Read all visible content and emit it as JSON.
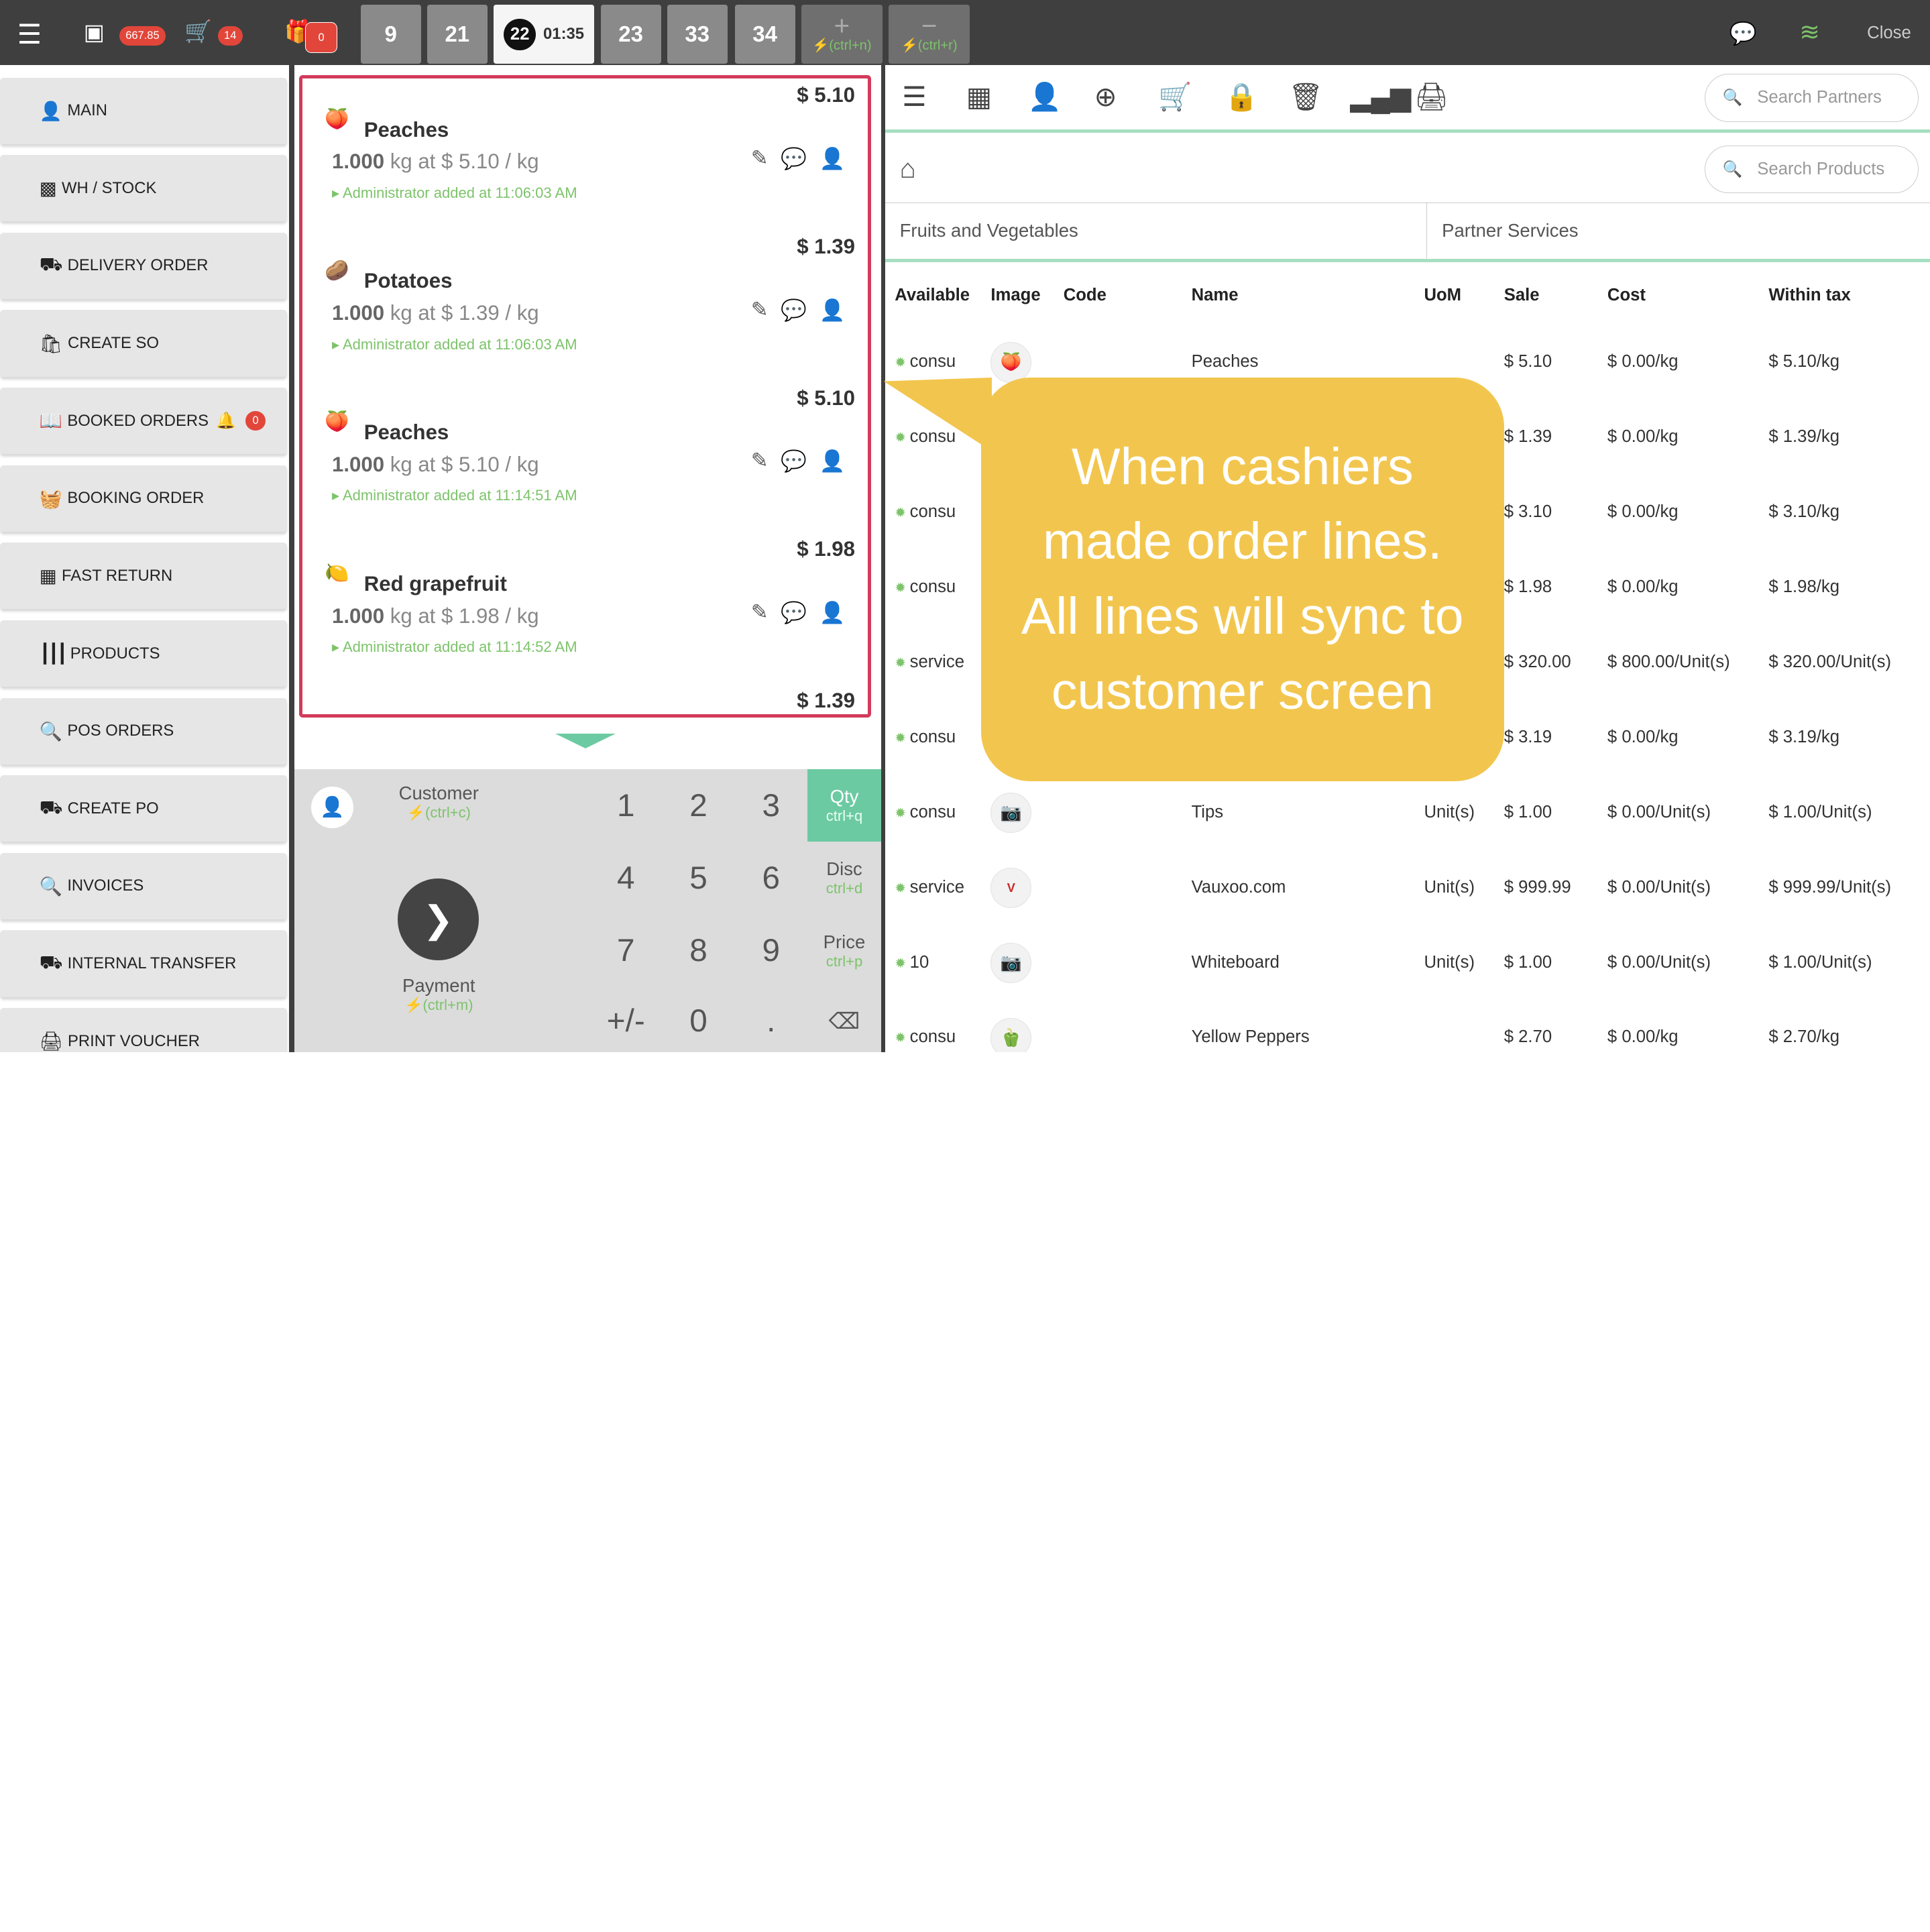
{
  "topbar": {
    "menu_icon": "list-icon",
    "cash_amount": "667.85",
    "cart_count": "14",
    "gift_count": "0",
    "order_tabs": [
      {
        "label": "9"
      },
      {
        "label": "21"
      },
      {
        "label": "22",
        "time": "01:35",
        "active": true
      },
      {
        "label": "23"
      },
      {
        "label": "33"
      },
      {
        "label": "34"
      }
    ],
    "add_tab_hint": "(ctrl+n)",
    "remove_tab_hint": "(ctrl+r)",
    "close_label": "Close"
  },
  "sidebar": {
    "items": [
      {
        "label": "MAIN",
        "icon": "user-icon"
      },
      {
        "label": "WH / STOCK",
        "icon": "sitemap-icon"
      },
      {
        "label": "DELIVERY ORDER",
        "icon": "truck-icon"
      },
      {
        "label": "CREATE SO",
        "icon": "shopping-bag-icon"
      },
      {
        "label": "BOOKED ORDERS",
        "icon": "book-icon",
        "badge": "0"
      },
      {
        "label": "BOOKING ORDER",
        "icon": "basket-icon"
      },
      {
        "label": "FAST RETURN",
        "icon": "building-icon"
      },
      {
        "label": "PRODUCTS",
        "icon": "barcode-icon"
      },
      {
        "label": "POS ORDERS",
        "icon": "search-icon"
      },
      {
        "label": "CREATE PO",
        "icon": "truck-icon"
      },
      {
        "label": "INVOICES",
        "icon": "search-icon"
      },
      {
        "label": "INTERNAL TRANSFER",
        "icon": "truck-icon"
      },
      {
        "label": "PRINT VOUCHER",
        "icon": "print-icon"
      }
    ]
  },
  "order_lines": [
    {
      "price": "$ 5.10",
      "name": "Peaches",
      "qty": "1.000",
      "unit_text": "kg at $ 5.10 / kg",
      "note": "Administrator added at 11:06:03 AM",
      "icon": "peach-icon"
    },
    {
      "price": "$ 1.39",
      "name": "Potatoes",
      "qty": "1.000",
      "unit_text": "kg at $ 1.39 / kg",
      "note": "Administrator added at 11:06:03 AM",
      "icon": "potato-icon"
    },
    {
      "price": "$ 5.10",
      "name": "Peaches",
      "qty": "1.000",
      "unit_text": "kg at $ 5.10 / kg",
      "note": "Administrator added at 11:14:51 AM",
      "icon": "peach-icon"
    },
    {
      "price": "$ 1.98",
      "name": "Red grapefruit",
      "qty": "1.000",
      "unit_text": "kg at $ 1.98 / kg",
      "note": "Administrator added at 11:14:52 AM",
      "icon": "grapefruit-icon"
    },
    {
      "price": "$ 1.39",
      "name": "",
      "qty": "",
      "unit_text": "",
      "note": "",
      "icon": ""
    }
  ],
  "keypad": {
    "customer_label": "Customer",
    "customer_hint": "(ctrl+c)",
    "payment_label": "Payment",
    "payment_hint": "(ctrl+m)",
    "keys": [
      "1",
      "2",
      "3",
      "4",
      "5",
      "6",
      "7",
      "8",
      "9",
      "+/-",
      "0",
      "."
    ],
    "modes": [
      {
        "label": "Qty",
        "hint": "ctrl+q",
        "selected": true
      },
      {
        "label": "Disc",
        "hint": "ctrl+d"
      },
      {
        "label": "Price",
        "hint": "ctrl+p"
      }
    ]
  },
  "right": {
    "search_partners_placeholder": "Search Partners",
    "search_products_placeholder": "Search Products",
    "categories": [
      "Fruits and Vegetables",
      "Partner Services"
    ],
    "table": {
      "headers": [
        "Available",
        "Image",
        "Code",
        "Name",
        "UoM",
        "Sale",
        "Cost",
        "Within tax"
      ],
      "rows": [
        {
          "available": "consu",
          "name": "Peaches",
          "uom": "",
          "sale": "$ 5.10",
          "cost": "$ 0.00/kg",
          "tax": "$ 5.10/kg",
          "img": "peach"
        },
        {
          "available": "consu",
          "name": "",
          "uom": "",
          "sale": "$ 1.39",
          "cost": "$ 0.00/kg",
          "tax": "$ 1.39/kg",
          "img": ""
        },
        {
          "available": "consu",
          "name": "",
          "uom": "",
          "sale": "$ 3.10",
          "cost": "$ 0.00/kg",
          "tax": "$ 3.10/kg",
          "img": ""
        },
        {
          "available": "consu",
          "name": "",
          "uom": "",
          "sale": "$ 1.98",
          "cost": "$ 0.00/kg",
          "tax": "$ 1.98/kg",
          "img": ""
        },
        {
          "available": "service",
          "name": "",
          "uom": "",
          "sale": "$ 320.00",
          "cost": "$ 800.00/Unit(s)",
          "tax": "$ 320.00/Unit(s)",
          "img": ""
        },
        {
          "available": "consu",
          "name": "",
          "uom": "",
          "sale": "$ 3.19",
          "cost": "$ 0.00/kg",
          "tax": "$ 3.19/kg",
          "img": ""
        },
        {
          "available": "consu",
          "name": "Tips",
          "uom": "Unit(s)",
          "sale": "$ 1.00",
          "cost": "$ 0.00/Unit(s)",
          "tax": "$ 1.00/Unit(s)",
          "img": "camera"
        },
        {
          "available": "service",
          "name": "Vauxoo.com",
          "uom": "Unit(s)",
          "sale": "$ 999.99",
          "cost": "$ 0.00/Unit(s)",
          "tax": "$ 999.99/Unit(s)",
          "img": "vauxoo"
        },
        {
          "available": "10",
          "name": "Whiteboard",
          "uom": "Unit(s)",
          "sale": "$ 1.00",
          "cost": "$ 0.00/Unit(s)",
          "tax": "$ 1.00/Unit(s)",
          "img": "camera"
        },
        {
          "available": "consu",
          "name": "Yellow Peppers",
          "uom": "",
          "sale": "$ 2.70",
          "cost": "$ 0.00/kg",
          "tax": "$ 2.70/kg",
          "img": "pepper"
        }
      ]
    }
  },
  "callout": {
    "lines": [
      "When cashiers",
      "made order lines.",
      "All lines will sync to",
      "customer screen"
    ]
  },
  "colors": {
    "accent_green": "#6ccaa2",
    "hint_green": "#7dc36b",
    "badge_red": "#e2463a",
    "callout_yellow": "#f2c64e",
    "highlight_border": "#d23b5a"
  }
}
